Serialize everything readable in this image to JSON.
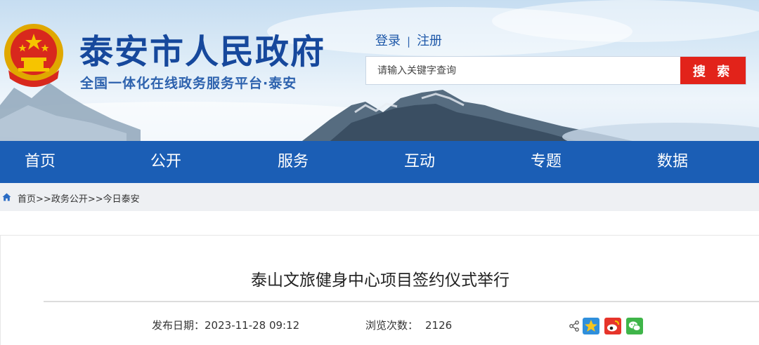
{
  "header": {
    "site_title": "泰安市人民政府",
    "site_subtitle": "全国一体化在线政务服务平台·泰安",
    "auth": {
      "login": "登录",
      "separator": "|",
      "register": "注册"
    },
    "search": {
      "placeholder": "请输入关键字查询",
      "button_label": "搜 索"
    },
    "colors": {
      "title": "#16489c",
      "search_button": "#e2231a"
    }
  },
  "nav": {
    "items": [
      {
        "label": "首页"
      },
      {
        "label": "公开"
      },
      {
        "label": "服务"
      },
      {
        "label": "互动"
      },
      {
        "label": "专题"
      },
      {
        "label": "数据"
      }
    ],
    "color": "#1b5eb5"
  },
  "breadcrumb": {
    "icon": "home-icon",
    "items": [
      "首页",
      "政务公开",
      "今日泰安"
    ],
    "separator": ">>"
  },
  "article": {
    "title": "泰山文旅健身中心项目签约仪式举行",
    "publish_label": "发布日期：",
    "publish_date": "2023-11-28 09:12",
    "views_label": "浏览次数：",
    "views": "2126",
    "share_icons": [
      "share-icon",
      "qzone-icon",
      "weibo-icon",
      "wechat-icon"
    ]
  }
}
